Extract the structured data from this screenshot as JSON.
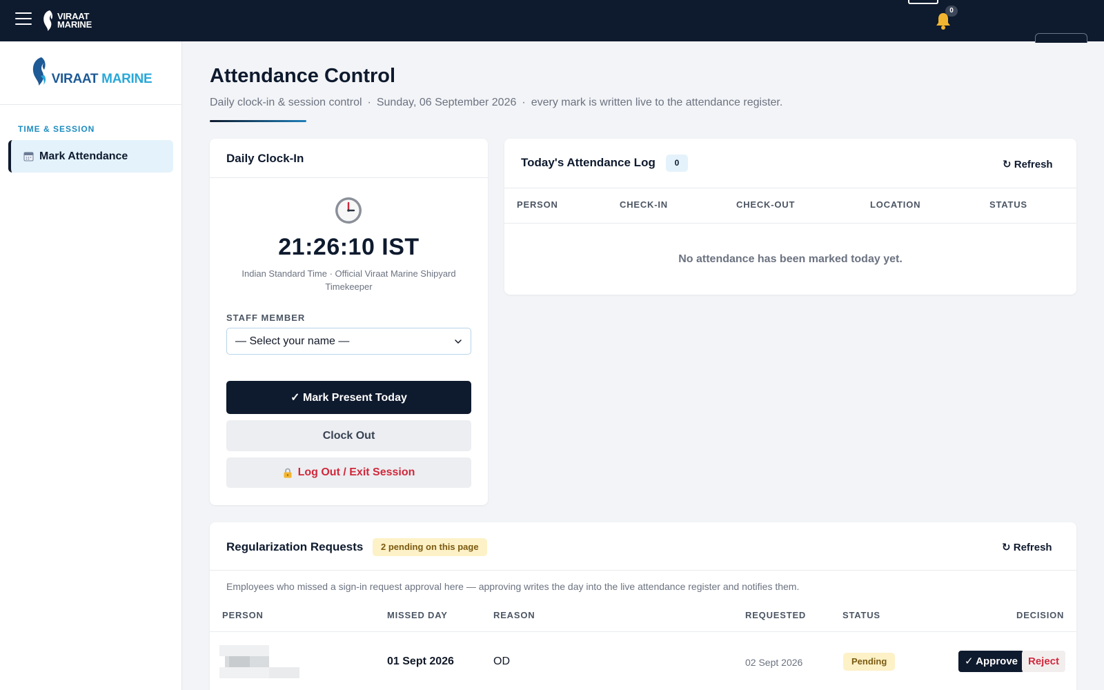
{
  "topbar": {
    "logo_line1": "VIRAAT",
    "logo_line2": "MARINE",
    "notification_count": "0"
  },
  "sidebar": {
    "brand_part1": "VIRAAT",
    "brand_part2": "MARINE",
    "section_title": "TIME & SESSION",
    "items": [
      {
        "label": "Mark Attendance",
        "icon": "calendar-icon",
        "active": true
      }
    ]
  },
  "header": {
    "title": "Attendance Control",
    "subtitle_part1": "Daily clock-in & session control",
    "subtitle_separator": "·",
    "subtitle_date": "Sunday, 06 September 2026",
    "subtitle_part3": "every mark is written live to the attendance register."
  },
  "clock_card": {
    "title": "Daily Clock-In",
    "time": "21:26:10 IST",
    "note": "Indian Standard Time · Official Viraat Marine Shipyard Timekeeper",
    "staff_label": "STAFF MEMBER",
    "staff_select_value": "— Select your name —",
    "mark_present_label": "✓ Mark Present Today",
    "clock_out_label": "Clock Out",
    "logout_label": "Log Out / Exit Session"
  },
  "log_card": {
    "title": "Today's Attendance Log",
    "count": "0",
    "refresh_label": "↻ Refresh",
    "columns": [
      "PERSON",
      "CHECK-IN",
      "CHECK-OUT",
      "LOCATION",
      "STATUS"
    ],
    "empty_message": "No attendance has been marked today yet."
  },
  "regularization": {
    "title": "Regularization Requests",
    "pending_badge": "2 pending on this page",
    "refresh_label": "↻ Refresh",
    "description": "Employees who missed a sign-in request approval here — approving writes the day into the live attendance register and notifies them.",
    "columns": [
      "PERSON",
      "MISSED DAY",
      "REASON",
      "REQUESTED",
      "STATUS",
      "DECISION"
    ],
    "rows": [
      {
        "missed_day": "01 Sept 2026",
        "reason": "OD",
        "requested": "02 Sept 2026",
        "status": "Pending",
        "approve_label": "✓ Approve",
        "reject_label": "Reject"
      }
    ]
  },
  "colors": {
    "navy": "#0e1a2e",
    "accent_blue": "#1b8cc0",
    "active_bg": "#e4f2fb",
    "pending_bg": "#fdf1c7",
    "danger": "#d0283c"
  }
}
